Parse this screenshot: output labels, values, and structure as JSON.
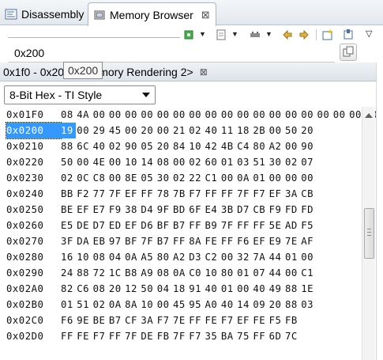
{
  "view_tabs": [
    {
      "label": "Disassembly",
      "active": false,
      "icon": "disassembly-icon"
    },
    {
      "label": "Memory Browser",
      "active": true,
      "icon": "memory-icon",
      "close": "⊠"
    }
  ],
  "address_input": {
    "value": "0x200"
  },
  "toolbar": {
    "icons": [
      "go-green-icon",
      "dropdown",
      "import-icon",
      "dropdown",
      "connect-icon",
      "dropdown",
      "prev-next-icon",
      "prev-next-icon",
      "new-tab-icon",
      "pin-icon",
      "view-menu-chevron"
    ]
  },
  "rendering_tab": {
    "label_left": "0x1f0 - 0x20",
    "label_right": ") <Memory Rendering 2>",
    "close": "⊠"
  },
  "tooltip": "0x200",
  "format_select": {
    "value": "8-Bit Hex - TI Style"
  },
  "selection": {
    "address": "0x0200",
    "cell_index": 0
  },
  "memory_rows": [
    {
      "addr": "0x01F0",
      "bytes": [
        "08",
        "4A",
        "00",
        "00",
        "00",
        "00",
        "00",
        "00",
        "00",
        "00",
        "00",
        "00",
        "00",
        "00",
        "00",
        "00",
        "00",
        "00",
        "00",
        "00"
      ]
    },
    {
      "addr": "0x0200",
      "bytes": [
        "19",
        "00",
        "29",
        "45",
        "00",
        "20",
        "00",
        "21",
        "02",
        "40",
        "11",
        "18",
        "2B",
        "00",
        "50",
        "20"
      ]
    },
    {
      "addr": "0x0210",
      "bytes": [
        "88",
        "6C",
        "40",
        "02",
        "90",
        "05",
        "20",
        "84",
        "10",
        "42",
        "4B",
        "C4",
        "80",
        "A2",
        "00",
        "90"
      ]
    },
    {
      "addr": "0x0220",
      "bytes": [
        "50",
        "00",
        "4E",
        "00",
        "10",
        "14",
        "08",
        "00",
        "02",
        "60",
        "01",
        "03",
        "51",
        "30",
        "02",
        "07"
      ]
    },
    {
      "addr": "0x0230",
      "bytes": [
        "02",
        "0C",
        "C8",
        "00",
        "8E",
        "05",
        "30",
        "02",
        "22",
        "C1",
        "00",
        "0A",
        "01",
        "00",
        "00",
        "00"
      ]
    },
    {
      "addr": "0x0240",
      "bytes": [
        "BB",
        "F2",
        "77",
        "7F",
        "EF",
        "FF",
        "78",
        "7B",
        "F7",
        "FF",
        "FF",
        "7F",
        "F7",
        "EF",
        "3A",
        "CB"
      ]
    },
    {
      "addr": "0x0250",
      "bytes": [
        "BE",
        "EF",
        "E7",
        "F9",
        "38",
        "D4",
        "9F",
        "BD",
        "6F",
        "E4",
        "3B",
        "D7",
        "CB",
        "F9",
        "FD",
        "FD"
      ]
    },
    {
      "addr": "0x0260",
      "bytes": [
        "E5",
        "DE",
        "D7",
        "ED",
        "EF",
        "D6",
        "BF",
        "B7",
        "FF",
        "B9",
        "7F",
        "FF",
        "FF",
        "5E",
        "AD",
        "F5"
      ]
    },
    {
      "addr": "0x0270",
      "bytes": [
        "3F",
        "DA",
        "EB",
        "97",
        "BF",
        "7F",
        "B7",
        "FF",
        "8A",
        "FE",
        "FF",
        "F6",
        "EF",
        "E9",
        "7E",
        "AF"
      ]
    },
    {
      "addr": "0x0280",
      "bytes": [
        "16",
        "10",
        "08",
        "04",
        "0A",
        "A5",
        "80",
        "A2",
        "D3",
        "C2",
        "00",
        "32",
        "7A",
        "44",
        "01",
        "00"
      ]
    },
    {
      "addr": "0x0290",
      "bytes": [
        "24",
        "88",
        "72",
        "1C",
        "B8",
        "A9",
        "08",
        "0A",
        "C0",
        "10",
        "80",
        "01",
        "07",
        "44",
        "00",
        "C1"
      ]
    },
    {
      "addr": "0x02A0",
      "bytes": [
        "82",
        "C6",
        "08",
        "20",
        "12",
        "50",
        "04",
        "18",
        "91",
        "40",
        "01",
        "00",
        "40",
        "49",
        "88",
        "1E"
      ]
    },
    {
      "addr": "0x02B0",
      "bytes": [
        "01",
        "51",
        "02",
        "0A",
        "8A",
        "10",
        "00",
        "45",
        "95",
        "A0",
        "40",
        "14",
        "09",
        "20",
        "88",
        "03"
      ]
    },
    {
      "addr": "0x02C0",
      "bytes": [
        "F6",
        "9E",
        "BE",
        "B7",
        "CF",
        "3A",
        "F7",
        "7E",
        "FF",
        "FE",
        "F7",
        "EF",
        "FE",
        "F5",
        "FB",
        ""
      ]
    },
    {
      "addr": "0x02D0",
      "bytes": [
        "FF",
        "FE",
        "F7",
        "FF",
        "7F",
        "DE",
        "FB",
        "7F",
        "F7",
        "35",
        "BA",
        "75",
        "FF",
        "6D",
        "7C",
        ""
      ]
    }
  ],
  "colors": {
    "selection": "#3399ff",
    "tab_border": "#a9b6c5",
    "addr_text": "#111111"
  }
}
